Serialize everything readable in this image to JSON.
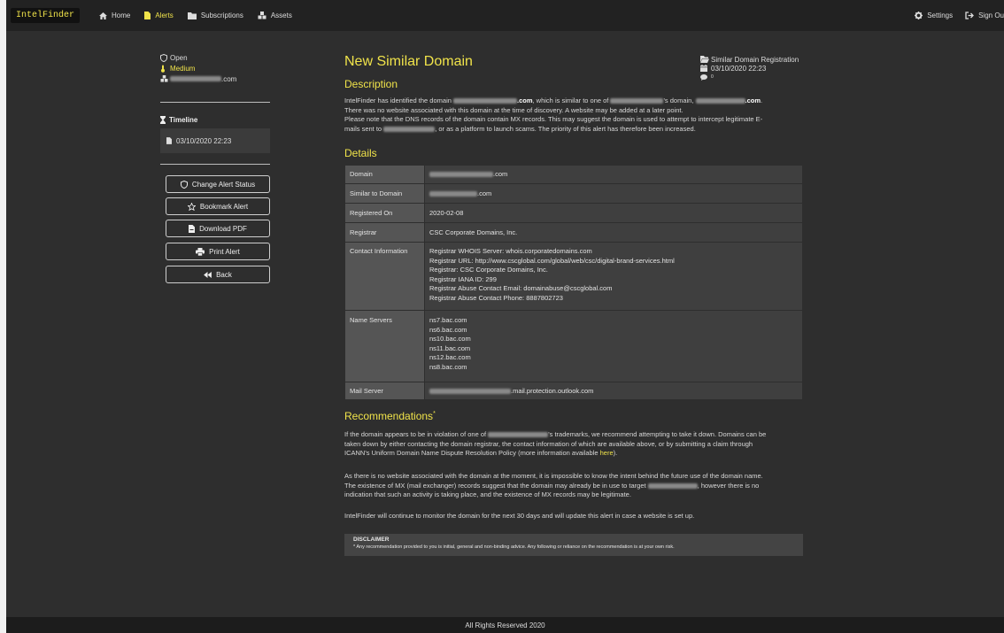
{
  "nav": {
    "brand": "IntelFinder",
    "home": "Home",
    "alerts": "Alerts",
    "subscriptions": "Subscriptions",
    "assets": "Assets",
    "settings": "Settings",
    "sign_out": "Sign Ou"
  },
  "sidebar": {
    "status": "Open",
    "severity": "Medium",
    "asset_suffix": ".com",
    "timeline_title": "Timeline",
    "timeline_date": "03/10/2020 22:23",
    "buttons": {
      "change_status": "Change Alert Status",
      "bookmark": "Bookmark Alert",
      "download": "Download PDF",
      "print": "Print Alert",
      "back": "Back"
    }
  },
  "header": {
    "title": "New Similar Domain",
    "alert_type": "Similar Domain Registration",
    "alert_date": "03/10/2020 22:23",
    "comment_count": "0"
  },
  "description": {
    "heading": "Description",
    "s1": "IntelFinder has identified the domain ",
    "s1_domain_suffix": ".com",
    "s2": ", which is similar to one of ",
    "s3": "'s domain, ",
    "s3_domain_suffix": ".com",
    "s4": ".",
    "line2": "There was no website associated with this domain at the time of discovery. A website may be added at a later point.",
    "line3": "Please note that the DNS records of the domain contain MX records. This may suggest the domain is used to attempt to intercept legitimate E-",
    "line4a": "mails sent to ",
    "line4b": ", or as a platform to launch scams. The priority of this alert has therefore been increased."
  },
  "details": {
    "heading": "Details",
    "rows": {
      "domain": {
        "label": "Domain",
        "value_suffix": ".com"
      },
      "similar": {
        "label": "Similar to Domain",
        "value_suffix": ".com"
      },
      "registered": {
        "label": "Registered On",
        "value": "2020-02-08"
      },
      "registrar": {
        "label": "Registrar",
        "value": "CSC Corporate Domains, Inc."
      },
      "contact": {
        "label": "Contact Information",
        "lines": [
          "Registrar WHOIS Server: whois.corporatedomains.com",
          "Registrar URL: http://www.cscglobal.com/global/web/csc/digital-brand-services.html",
          "Registrar: CSC Corporate Domains, Inc.",
          "Registrar IANA ID: 299",
          "Registrar Abuse Contact Email: domainabuse@cscglobal.com",
          "Registrar Abuse Contact Phone: 8887802723"
        ]
      },
      "ns": {
        "label": "Name Servers",
        "lines": [
          "ns7.bac.com",
          "ns6.bac.com",
          "ns10.bac.com",
          "ns11.bac.com",
          "ns12.bac.com",
          "ns8.bac.com"
        ]
      },
      "mail": {
        "label": "Mail Server",
        "value_suffix": ".mail.protection.outlook.com"
      }
    }
  },
  "recommendations": {
    "heading": "Recommendations",
    "marker": "*",
    "p1a": "If the domain appears to be in violation of one of ",
    "p1b": "'s trademarks, we recommend attempting to take it down. Domains can be",
    "p1c": "taken down by either contacting the domain registrar, the contact information of which are available above, or by submitting a claim through",
    "p1d": "ICANN's Uniform Domain Name Dispute Resolution Policy (more information available ",
    "p1_link": "here",
    "p1e": ").",
    "p2a": "As there is no website associated with the domain at the moment, it is impossible to know the intent behind the future use of the domain name.",
    "p2b": "The existence of MX (mail exchanger) records suggest that the domain may already be in use to target ",
    "p2c": ", however there is no",
    "p2d": "indication that such an activity is taking place, and the existence of MX records may be legitimate.",
    "p3": "IntelFinder will continue to monitor the domain for the next 30 days and will update this alert in case a website is set up."
  },
  "disclaimer": {
    "title": "DISCLAIMER",
    "text": "* Any recommendation provided to you is initial, general and non-binding advice. Any following or reliance on the recommendation is at your own risk."
  },
  "footer": {
    "text": "All Rights Reserved 2020"
  },
  "colors": {
    "accent": "#f0e34a",
    "background": "#2e2e2e",
    "navbar": "#222222"
  }
}
